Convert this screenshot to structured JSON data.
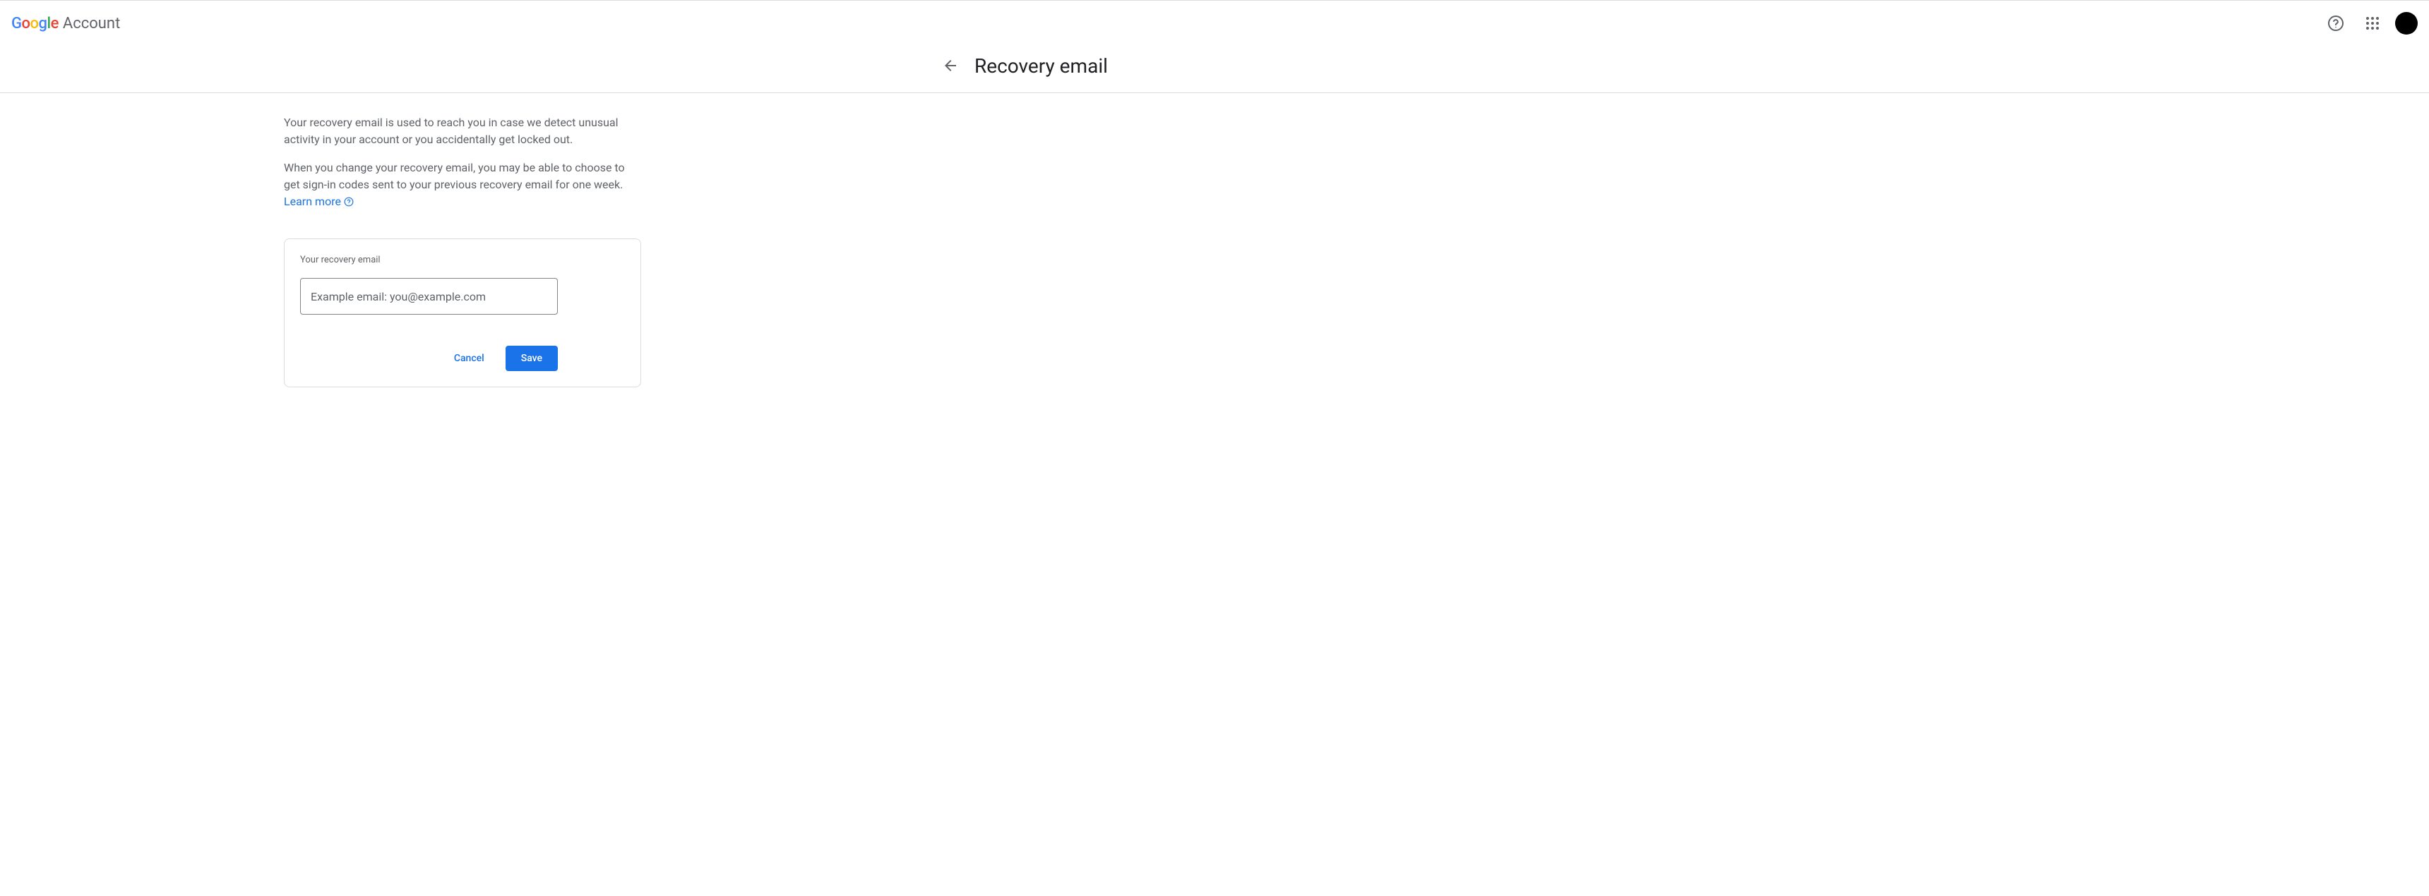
{
  "header": {
    "product_name": "Account"
  },
  "page": {
    "title": "Recovery email",
    "description1": "Your recovery email is used to reach you in case we detect unusual activity in your account or you accidentally get locked out.",
    "description2": "When you change your recovery email, you may be able to choose to get sign-in codes sent to your previous recovery email for one week.",
    "learn_more_label": "Learn more"
  },
  "form": {
    "field_label": "Your recovery email",
    "placeholder": "Example email: you@example.com",
    "value": "",
    "cancel_label": "Cancel",
    "save_label": "Save"
  }
}
